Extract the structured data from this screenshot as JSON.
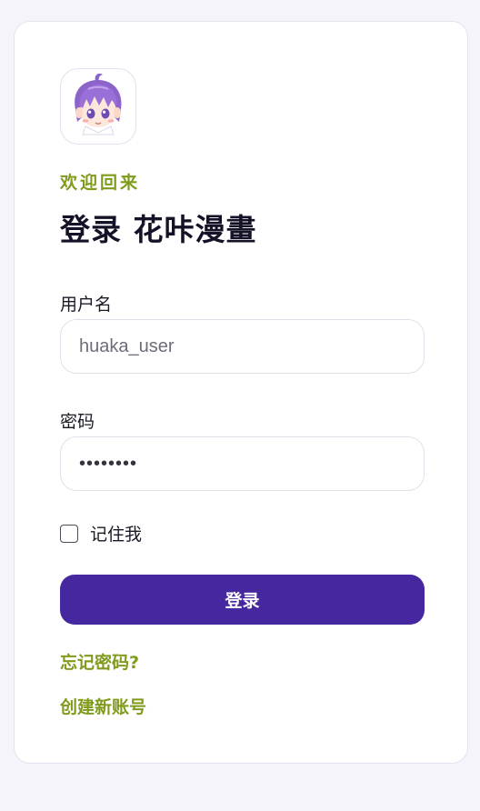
{
  "colors": {
    "page_background": "#f5f4fb",
    "card_background": "#ffffff",
    "accent_green": "#7f9b1c",
    "primary_purple": "#4527a0",
    "title_text": "#141227"
  },
  "header": {
    "avatar_icon": "anime-character-avatar",
    "eyebrow": "欢迎回来",
    "title": "登录 花咔漫畫"
  },
  "form": {
    "username_label": "用户名",
    "username_placeholder": "huaka_user",
    "password_label": "密码",
    "password_value": "••••••••",
    "remember_label": "记住我",
    "remember_checked": false,
    "submit_label": "登录"
  },
  "links": {
    "forgot_password": "忘记密码?",
    "create_account": "创建新账号"
  }
}
